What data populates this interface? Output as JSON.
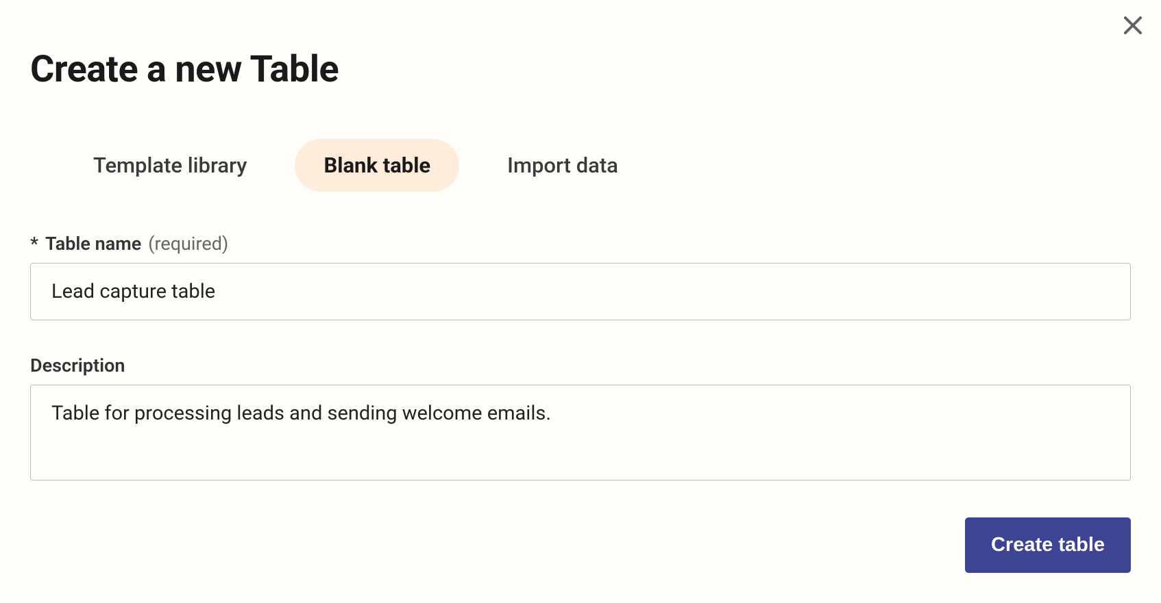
{
  "modal": {
    "title": "Create a new Table",
    "tabs": [
      {
        "label": "Template library",
        "active": false
      },
      {
        "label": "Blank table",
        "active": true
      },
      {
        "label": "Import data",
        "active": false
      }
    ],
    "form": {
      "tableName": {
        "asterisk": "*",
        "label": "Table name",
        "requiredHint": "(required)",
        "value": "Lead capture table"
      },
      "description": {
        "label": "Description",
        "value": "Table for processing leads and sending welcome emails."
      }
    },
    "submitLabel": "Create table"
  }
}
